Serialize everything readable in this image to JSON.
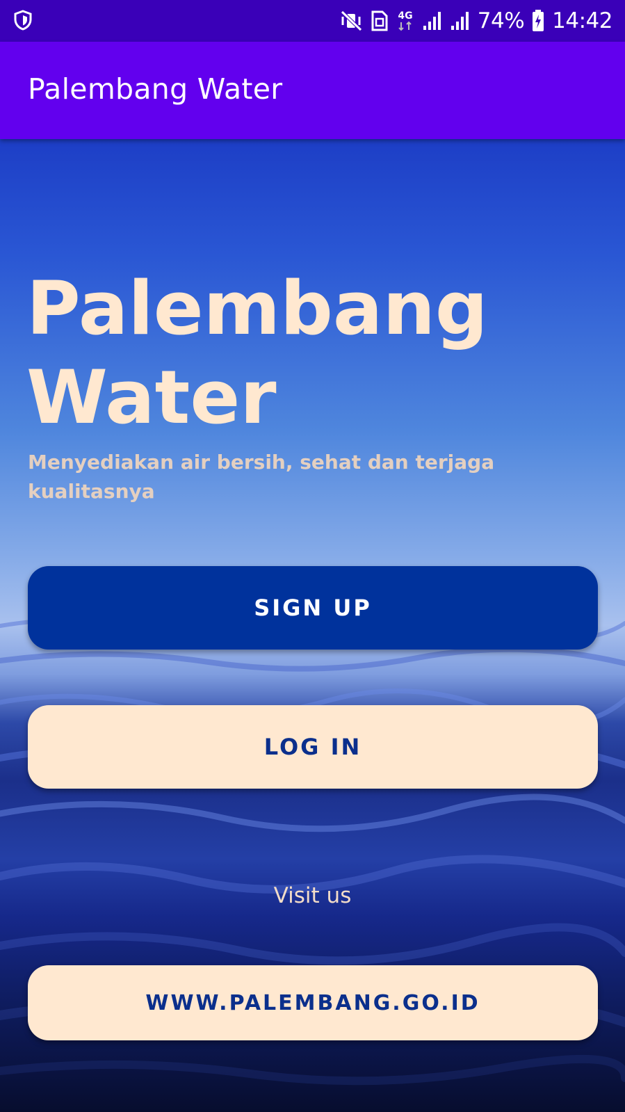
{
  "status_bar": {
    "left_icon": "shield-icon",
    "icons": [
      "vibrate-mute-icon",
      "sim-card-icon",
      "network-4g-icon",
      "signal-icon",
      "signal-icon",
      "battery-charging-icon"
    ],
    "network_label": "4G",
    "battery_percent": "74%",
    "time": "14:42"
  },
  "app_bar": {
    "title": "Palembang Water"
  },
  "hero": {
    "title": "Palembang Water",
    "subtitle": "Menyediakan air bersih, sehat dan terjaga kualitasnya"
  },
  "actions": {
    "signup_label": "SIGN UP",
    "login_label": "LOG IN"
  },
  "visit": {
    "label": "Visit us",
    "website_label": "WWW.PALEMBANG.GO.ID"
  },
  "colors": {
    "status_bar": "#3a00b8",
    "app_bar": "#6200ee",
    "hero_text": "#ffe8d0",
    "signup_button": "#00329c",
    "light_button": "#ffe8d0",
    "light_button_text": "#0b2f8c"
  }
}
